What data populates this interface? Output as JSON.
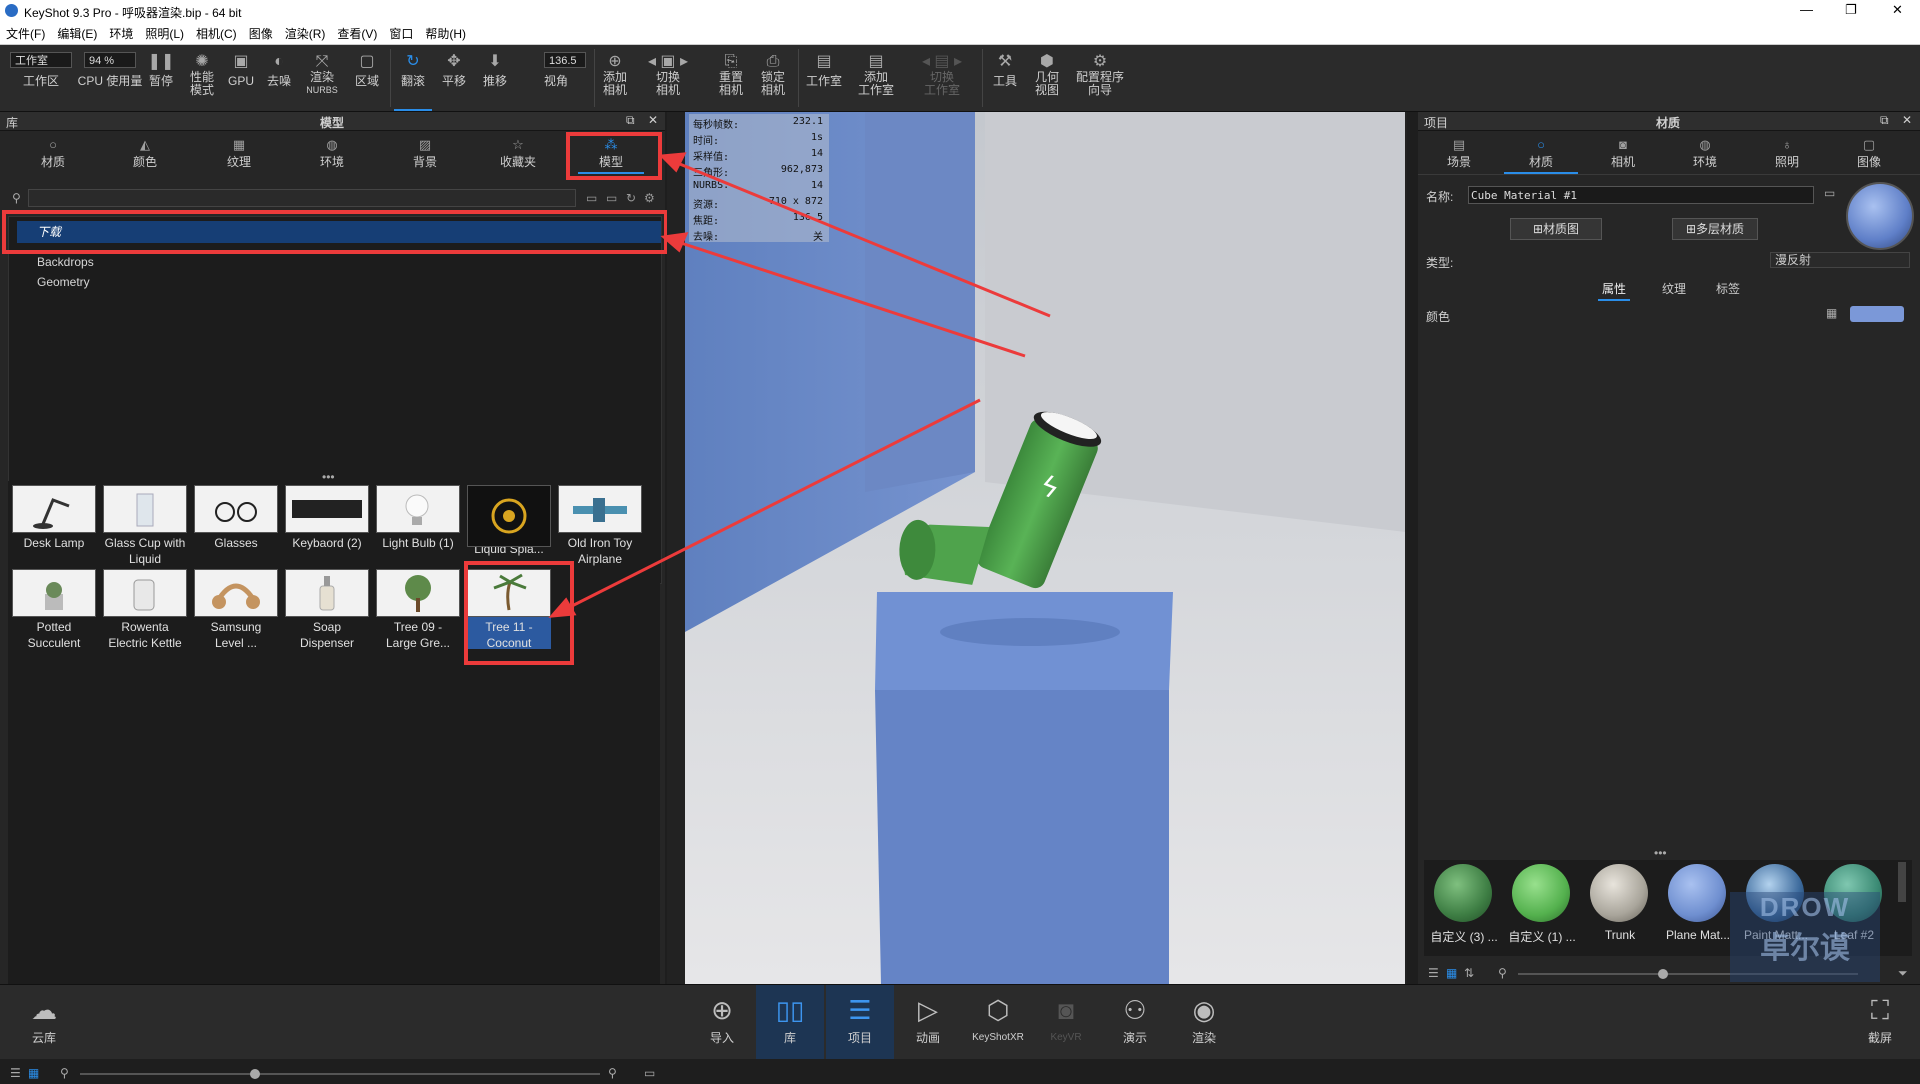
{
  "window": {
    "title": "KeyShot 9.3 Pro  - 呼吸器渲染.bip  - 64 bit"
  },
  "menu": [
    "文件(F)",
    "编辑(E)",
    "环境",
    "照明(L)",
    "相机(C)",
    "图像",
    "渲染(R)",
    "查看(V)",
    "窗口",
    "帮助(H)"
  ],
  "toolbar": {
    "workspace_select": "工作室",
    "zoom_value": "94 %",
    "fov_value": "136.5",
    "items": {
      "workarea": "工作区",
      "cpu": "CPU 使用量",
      "pause": "暂停",
      "perf1": "性能",
      "perf2": "模式",
      "gpu": "GPU",
      "denoise": "去噪",
      "nurbs1": "渲染",
      "nurbs2": "NURBS",
      "region": "区域",
      "tumble": "翻滚",
      "pan": "平移",
      "dolly": "推移",
      "fov": "视角",
      "addcam1": "添加",
      "addcam2": "相机",
      "switchcam1": "切换",
      "switchcam2": "相机",
      "resetcam1": "重置",
      "resetcam2": "相机",
      "lockcam1": "锁定",
      "lockcam2": "相机",
      "studio": "工作室",
      "addstudio1": "添加",
      "addstudio2": "工作室",
      "switchstudio1": "切换",
      "switchstudio2": "工作室",
      "tools": "工具",
      "geo1": "几何",
      "geo2": "视图",
      "wizard1": "配置程序",
      "wizard2": "向导"
    }
  },
  "library": {
    "panel_label": "库",
    "panel_title": "模型",
    "tabs": [
      "材质",
      "颜色",
      "纹理",
      "环境",
      "背景",
      "收藏夹",
      "模型"
    ],
    "tree_selected": "下载",
    "tree_items": [
      "Backdrops",
      "Geometry"
    ],
    "models": [
      {
        "line1": "Desk Lamp",
        "line2": ""
      },
      {
        "line1": "Glass Cup with",
        "line2": "Liquid"
      },
      {
        "line1": "Glasses",
        "line2": ""
      },
      {
        "line1": "Keybaord (2)",
        "line2": ""
      },
      {
        "line1": "Light Bulb (1)",
        "line2": ""
      },
      {
        "line1": "Liquid Spla...",
        "line2": ""
      },
      {
        "line1": "Old Iron Toy",
        "line2": "Airplane"
      },
      {
        "line1": "Potted",
        "line2": "Succulent"
      },
      {
        "line1": "Rowenta",
        "line2": "Electric Kettle"
      },
      {
        "line1": "Samsung",
        "line2": "Level ..."
      },
      {
        "line1": "Soap",
        "line2": "Dispenser"
      },
      {
        "line1": "Tree 09 -",
        "line2": "Large Gre..."
      },
      {
        "line1": "Tree 11 -",
        "line2": "Coconut"
      }
    ]
  },
  "hud": [
    {
      "k": "每秒帧数:",
      "v": "232.1"
    },
    {
      "k": "时间:",
      "v": "1s"
    },
    {
      "k": "采样值:",
      "v": "14"
    },
    {
      "k": "三角形:",
      "v": "962,873"
    },
    {
      "k": "NURBS:",
      "v": "14"
    },
    {
      "k": "资源:",
      "v": "710 x 872"
    },
    {
      "k": "焦距:",
      "v": "136.5"
    },
    {
      "k": "去噪:",
      "v": "关"
    }
  ],
  "project": {
    "panel_label": "项目",
    "panel_title": "材质",
    "tabs": [
      "场景",
      "材质",
      "相机",
      "环境",
      "照明",
      "图像"
    ],
    "name_label": "名称:",
    "name_value": "Cube Material #1",
    "btn_graph": "材质图",
    "btn_multi": "多层材质",
    "type_label": "类型:",
    "type_value": "漫反射",
    "subtabs": [
      "属性",
      "纹理",
      "标签"
    ],
    "color_label": "颜色",
    "color_hex": "#7b98d8",
    "materials": [
      "自定义 (3) ...",
      "自定义 (1) ...",
      "Trunk",
      "Plane Mat...",
      "Paint Matt...",
      "Leaf #2"
    ]
  },
  "bottombar": {
    "cloud": "云库",
    "items": [
      "导入",
      "库",
      "项目",
      "动画",
      "KeyShotXR",
      "KeyVR",
      "演示",
      "渲染"
    ],
    "screenshot": "截屏"
  },
  "watermark": {
    "line1": "DROW",
    "line2": "卓尔谟"
  }
}
